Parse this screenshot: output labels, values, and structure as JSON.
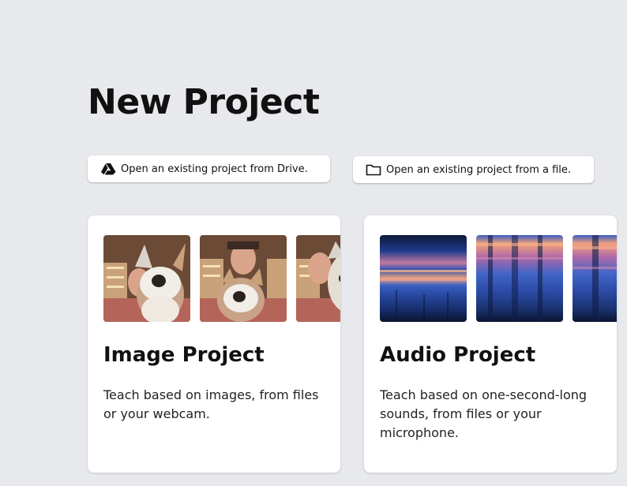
{
  "page": {
    "title": "New Project"
  },
  "open_buttons": {
    "drive": {
      "label": "Open an existing project from Drive.",
      "icon": "google-drive-icon"
    },
    "file": {
      "label": "Open an existing project from a file.",
      "icon": "folder-icon"
    }
  },
  "projects": [
    {
      "title": "Image Project",
      "description": "Teach based on images, from files or your webcam.",
      "thumbnails": [
        "corgi-plush-photo",
        "corgi-plush-photo",
        "corgi-plush-photo"
      ]
    },
    {
      "title": "Audio Project",
      "description": "Teach based on one-second-long sounds, from files or your microphone.",
      "thumbnails": [
        "spectrogram",
        "spectrogram",
        "spectrogram"
      ]
    }
  ]
}
